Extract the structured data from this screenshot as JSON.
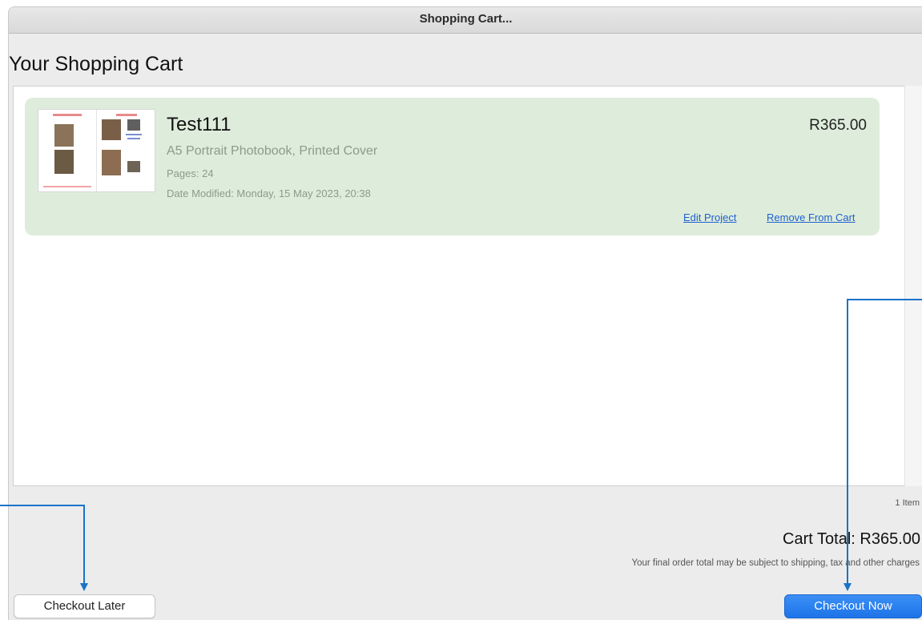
{
  "window": {
    "title": "Shopping Cart..."
  },
  "page": {
    "heading": "Your Shopping Cart"
  },
  "cart_items": [
    {
      "title": "Test111",
      "price": "R365.00",
      "description": "A5 Portrait Photobook, Printed Cover",
      "pages": "Pages: 24",
      "date_modified": "Date Modified: Monday, 15 May 2023, 20:38",
      "edit_label": "Edit Project",
      "remove_label": "Remove From Cart"
    }
  ],
  "summary": {
    "item_count": "1 Item",
    "total_label": "Cart Total:",
    "total_value": "R365.00",
    "disclaimer": "Your final order total may be subject to shipping, tax and other charges"
  },
  "buttons": {
    "checkout_later": "Checkout Later",
    "checkout_now": "Checkout Now"
  },
  "colors": {
    "item_background": "#deeddb",
    "link": "#1f5fd1",
    "primary_button": "#1d74e8",
    "annotation_arrow": "#1a73c9"
  }
}
